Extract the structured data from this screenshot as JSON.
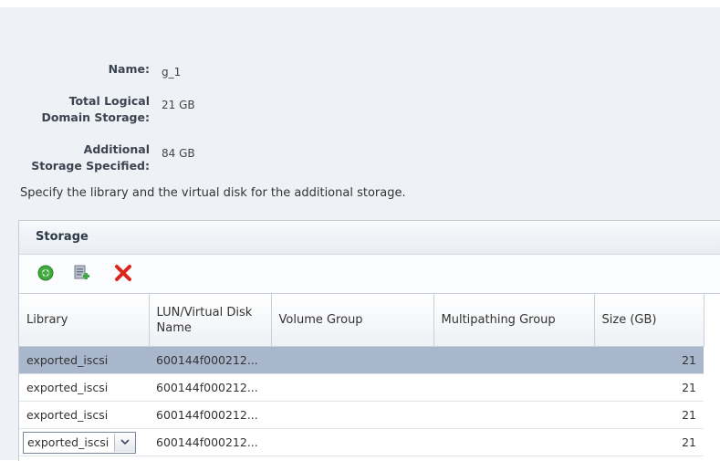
{
  "details": {
    "name_label": "Name:",
    "name_value": "g_1",
    "total_storage_label_1": "Total Logical",
    "total_storage_label_2": "Domain Storage:",
    "total_storage_value": "21 GB",
    "additional_label_1": "Additional",
    "additional_label_2": "Storage Specified:",
    "additional_value": "84 GB"
  },
  "instruction": "Specify the library and the virtual disk for the additional storage.",
  "storage": {
    "title": "Storage",
    "toolbar": {
      "add_icon": "add-circle-icon",
      "add_from_icon": "add-disk-icon",
      "delete_icon": "delete-x-icon",
      "colors": {
        "add": "#3faa3f",
        "delete": "#d8261c"
      }
    },
    "columns": [
      "Library",
      "LUN/Virtual Disk Name",
      "Volume Group",
      "Multipathing Group",
      "Size (GB)"
    ],
    "rows": [
      {
        "library": "exported_iscsi",
        "lun": "600144f000212...",
        "volume_group": "",
        "multipathing_group": "",
        "size": "21",
        "selected": true
      },
      {
        "library": "exported_iscsi",
        "lun": "600144f000212...",
        "volume_group": "",
        "multipathing_group": "",
        "size": "21",
        "selected": false
      },
      {
        "library": "exported_iscsi",
        "lun": "600144f000212...",
        "volume_group": "",
        "multipathing_group": "",
        "size": "21",
        "selected": false
      },
      {
        "library": "exported_iscsi",
        "lun": "600144f000212...",
        "volume_group": "",
        "multipathing_group": "",
        "size": "21",
        "selected": false,
        "editing": true
      }
    ]
  }
}
